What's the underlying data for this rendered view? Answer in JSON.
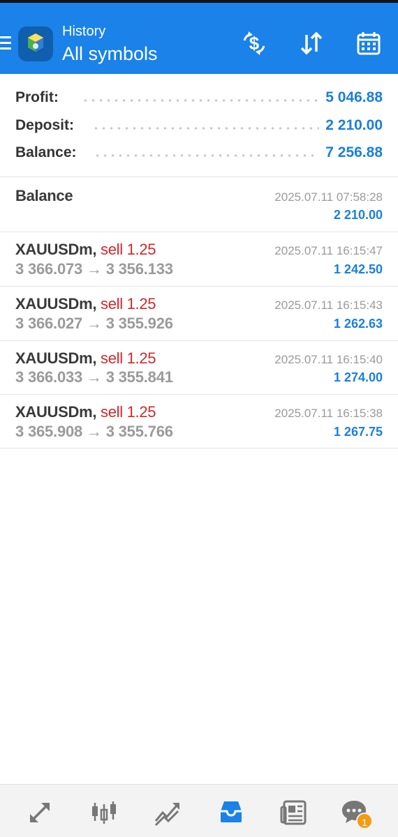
{
  "header": {
    "title_small": "History",
    "title_big": "All symbols",
    "accent_color": "#1a82e8",
    "icons": [
      "menu-icon",
      "app-logo",
      "dollar-exchange-icon",
      "sort-icon",
      "calendar-icon"
    ]
  },
  "summary": {
    "profit_label": "Profit:",
    "profit_value": "5 046.88",
    "deposit_label": "Deposit:",
    "deposit_value": "2 210.00",
    "balance_label": "Balance:",
    "balance_value": "7 256.88"
  },
  "balance_entry": {
    "label": "Balance",
    "time": "2025.07.11 07:58:28",
    "amount": "2 210.00"
  },
  "trades": [
    {
      "symbol": "XAUUSDm,",
      "type": "sell 1.25",
      "prices": "3 366.073 → 3 356.133",
      "time": "2025.07.11 16:15:47",
      "profit": "1 242.50"
    },
    {
      "symbol": "XAUUSDm,",
      "type": "sell 1.25",
      "prices": "3 366.027 → 3 355.926",
      "time": "2025.07.11 16:15:43",
      "profit": "1 262.63"
    },
    {
      "symbol": "XAUUSDm,",
      "type": "sell 1.25",
      "prices": "3 366.033 → 3 355.841",
      "time": "2025.07.11 16:15:40",
      "profit": "1 274.00"
    },
    {
      "symbol": "XAUUSDm,",
      "type": "sell 1.25",
      "prices": "3 365.908 → 3 355.766",
      "time": "2025.07.11 16:15:38",
      "profit": "1 267.75"
    }
  ],
  "bottom_nav": {
    "items": [
      "quotes-icon",
      "chart-candles-icon",
      "trade-icon",
      "history-inbox-icon",
      "news-icon",
      "chat-icon"
    ],
    "active": "history-inbox-icon",
    "chat_badge": "1",
    "active_color": "#1a82e8",
    "badge_color": "#f39c12"
  }
}
